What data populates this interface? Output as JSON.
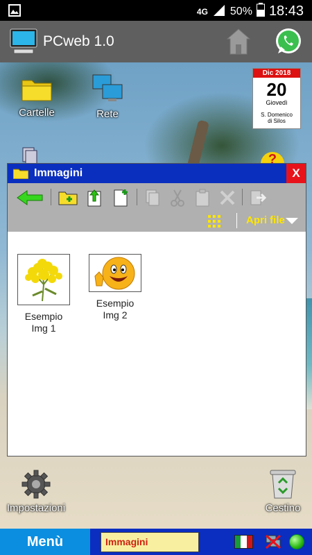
{
  "status_bar": {
    "network": "4G",
    "battery": "50%",
    "time": "18:43"
  },
  "app": {
    "title": "PCweb 1.0"
  },
  "desktop": {
    "icons": [
      {
        "label": "Cartelle"
      },
      {
        "label": "Rete"
      },
      {
        "label": "Impostazioni"
      },
      {
        "label": "Cestino"
      }
    ]
  },
  "calendar": {
    "month_year": "Dic 2018",
    "day": "20",
    "weekday": "Giovedì",
    "saint_line1": "S. Domenico",
    "saint_line2": "di Silos"
  },
  "window": {
    "title": "Immagini",
    "close_label": "X",
    "open_file_label": "Apri file",
    "files": [
      {
        "name_line1": "Esempio",
        "name_line2": "Img 1"
      },
      {
        "name_line1": "Esempio",
        "name_line2": "Img 2"
      }
    ]
  },
  "taskbar": {
    "menu_label": "Menù",
    "active_task": "Immagini"
  },
  "colors": {
    "title_bar": "#0a2fbf",
    "close": "#e8121b",
    "taskbar": "#0b2ec0",
    "menu": "#0b8ee0",
    "open_file_text": "#ffe600"
  }
}
